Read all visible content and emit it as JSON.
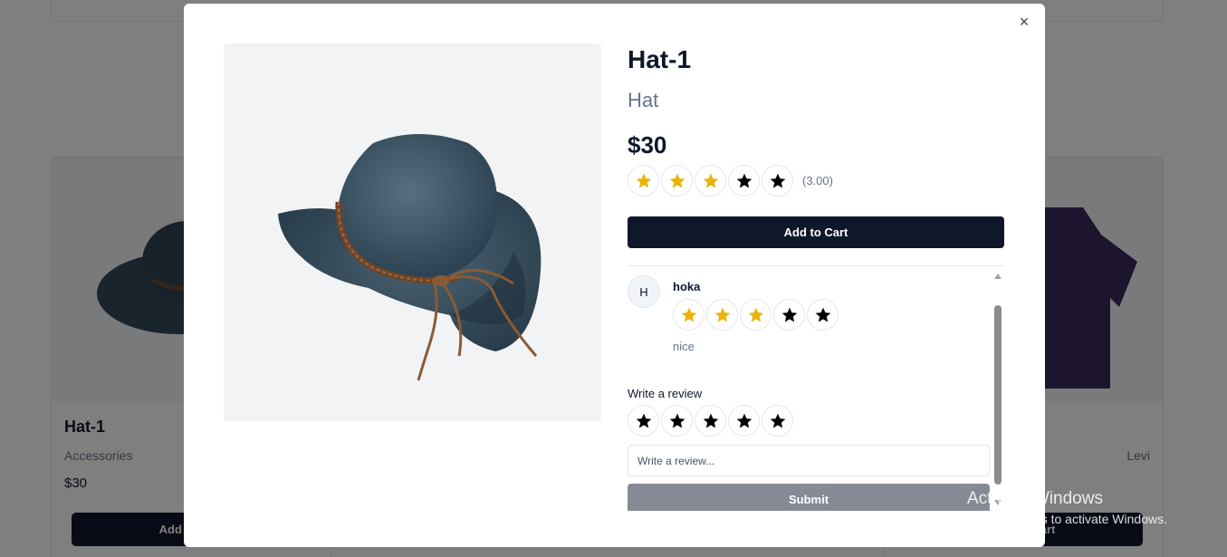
{
  "background": {
    "left_card": {
      "title": "Hat-1",
      "category": "Accessories",
      "price": "$30",
      "button": "Add to Cart"
    },
    "right_card": {
      "category": "Levi",
      "button": "Add to Cart"
    }
  },
  "modal": {
    "close_symbol": "×",
    "product": {
      "title": "Hat-1",
      "category": "Hat",
      "price": "$30",
      "rating": 3,
      "rating_text": "(3.00)",
      "add_to_cart": "Add to Cart"
    },
    "reviews": [
      {
        "avatar_initial": "H",
        "author": "hoka",
        "rating": 3,
        "text": "nice"
      }
    ],
    "write_review": {
      "label": "Write a review",
      "rating": 0,
      "placeholder": "Write a review...",
      "submit": "Submit"
    }
  },
  "colors": {
    "star_filled": "#eab308",
    "star_empty": "#000000",
    "primary": "#0f172a",
    "submit_disabled": "#868a94"
  },
  "watermark": {
    "title": "Activate Windows",
    "subtitle": "Go to Settings to activate Windows."
  }
}
